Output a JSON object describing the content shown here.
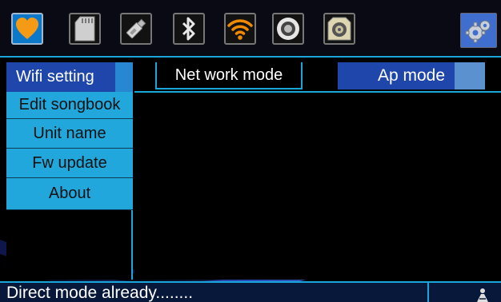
{
  "topbar": {
    "icons": [
      {
        "name": "favorite-heart-icon",
        "active": true
      },
      {
        "name": "sd-card-icon",
        "active": false
      },
      {
        "name": "usb-drive-icon",
        "active": false
      },
      {
        "name": "bluetooth-icon",
        "active": false
      },
      {
        "name": "wifi-icon",
        "active": false
      },
      {
        "name": "speaker-icon",
        "active": false
      },
      {
        "name": "subwoofer-icon",
        "active": false
      }
    ],
    "settings_icon": "settings-gear-icon"
  },
  "sidebar": {
    "items": [
      {
        "label": "Wifi setting",
        "selected": true
      },
      {
        "label": "Edit songbook",
        "selected": false
      },
      {
        "label": "Unit name",
        "selected": false
      },
      {
        "label": "Fw update",
        "selected": false
      },
      {
        "label": "About",
        "selected": false
      }
    ]
  },
  "main": {
    "net_work_mode_label": "Net work mode",
    "ap_mode_label": "Ap mode"
  },
  "status": {
    "message": "Direct mode already........"
  },
  "colors": {
    "accent": "#1aa6d8",
    "selected": "#1f46ab",
    "wifi_orange": "#f08a00",
    "heart_orange": "#f59a14"
  }
}
